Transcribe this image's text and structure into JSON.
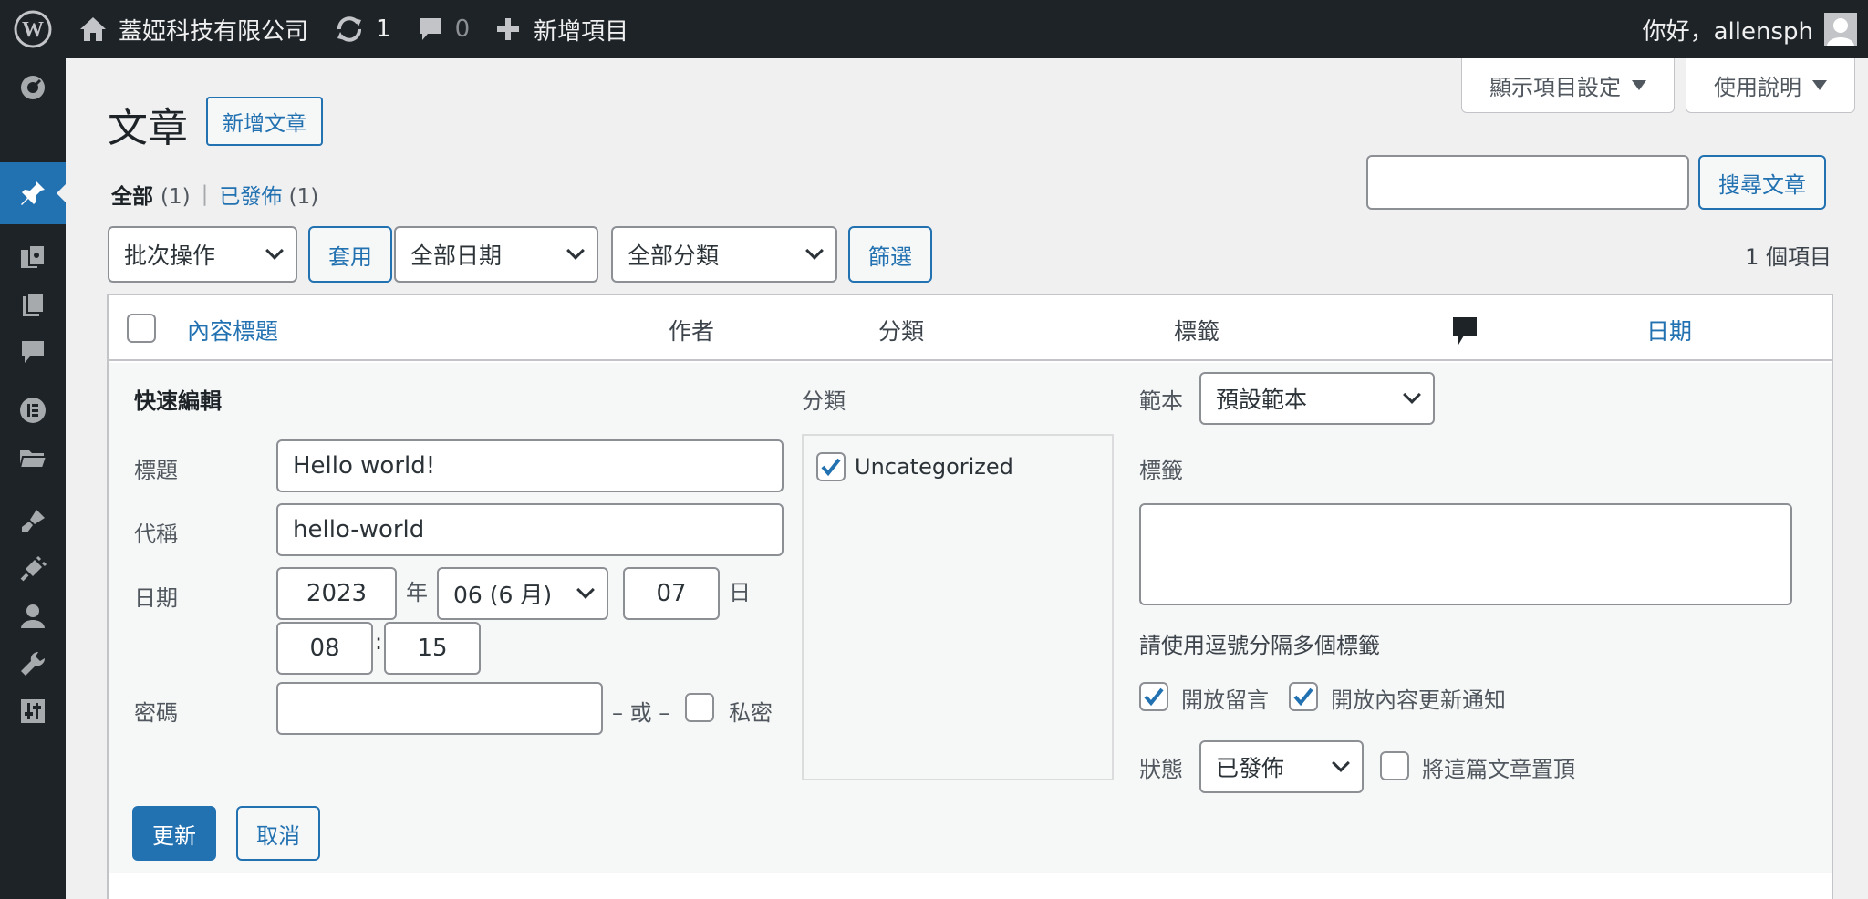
{
  "adminbar": {
    "site_name": "蓋婭科技有限公司",
    "updates_count": "1",
    "comments_count": "0",
    "new_label": "新增項目",
    "greeting": "你好，allensph"
  },
  "screen_tabs": {
    "screen_options": "顯示項目設定",
    "help": "使用說明"
  },
  "page": {
    "title": "文章",
    "add_new": "新增文章"
  },
  "views": {
    "all_label": "全部",
    "all_count": "(1)",
    "separator": "|",
    "published_label": "已發佈",
    "published_count": "(1)"
  },
  "search": {
    "button": "搜尋文章",
    "value": ""
  },
  "tablenav": {
    "bulk_action": "批次操作",
    "apply": "套用",
    "date_filter": "全部日期",
    "category_filter": "全部分類",
    "filter": "篩選",
    "items_count": "1 個項目"
  },
  "table": {
    "columns": {
      "title": "內容標題",
      "author": "作者",
      "categories": "分類",
      "tags": "標籤",
      "date": "日期"
    }
  },
  "quick_edit": {
    "heading": "快速編輯",
    "title_label": "標題",
    "title_value": "Hello world!",
    "slug_label": "代稱",
    "slug_value": "hello-world",
    "date_label": "日期",
    "year": "2023",
    "year_suffix": "年",
    "month": "06 (6 月)",
    "day": "07",
    "day_suffix": "日",
    "hour": "08",
    "time_sep": ":",
    "minute": "15",
    "password_label": "密碼",
    "password_value": "",
    "or_label": "– 或 –",
    "private_label": "私密",
    "categories_label": "分類",
    "category_item": "Uncategorized",
    "template_label": "範本",
    "template_value": "預設範本",
    "tags_label": "標籤",
    "tags_hint": "請使用逗號分隔多個標籤",
    "allow_comments": "開放留言",
    "allow_pings": "開放內容更新通知",
    "status_label": "狀態",
    "status_value": "已發佈",
    "sticky_label": "將這篇文章置頂",
    "update_button": "更新",
    "cancel_button": "取消"
  },
  "colors": {
    "accent": "#2271b1",
    "adminbar_bg": "#1d2327",
    "page_bg": "#f0f0f1"
  }
}
